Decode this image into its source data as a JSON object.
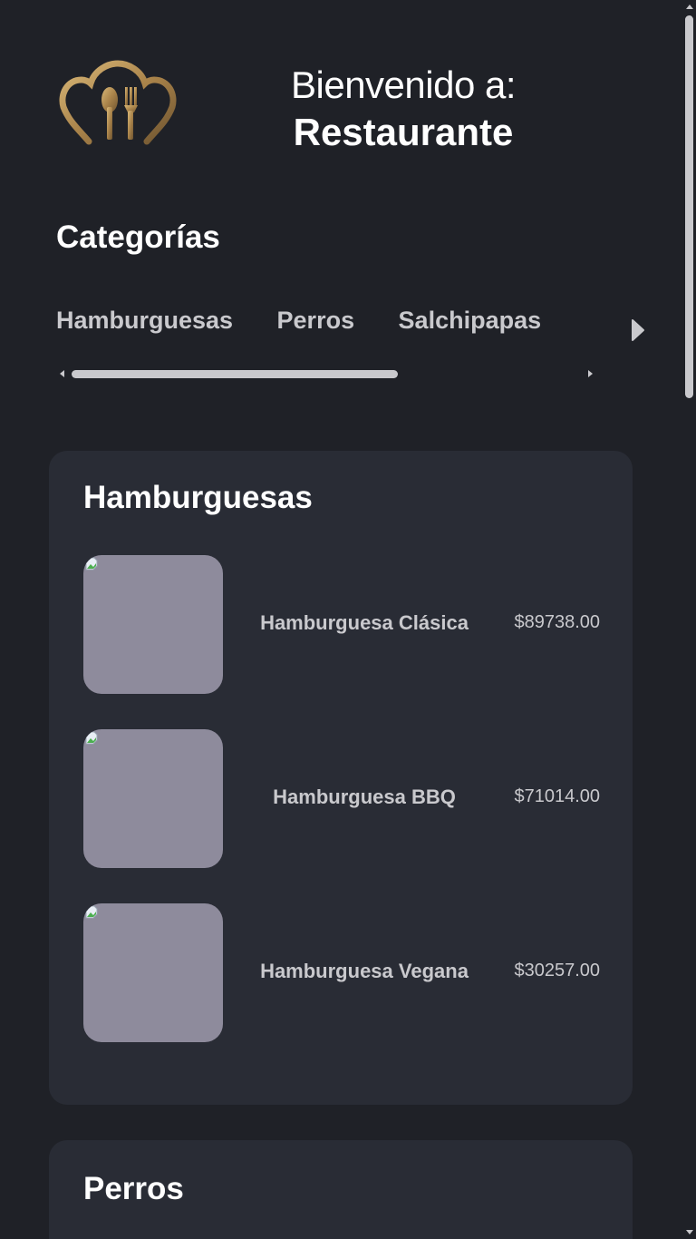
{
  "header": {
    "logo_icon": "chef-hat-spoon-fork-icon",
    "welcome_line": "Bienvenido a:",
    "restaurant_name": "Restaurante",
    "logo_color": "#b8935a"
  },
  "categories": {
    "title": "Categorías",
    "items": [
      {
        "label": "Hamburguesas"
      },
      {
        "label": "Perros"
      },
      {
        "label": "Salchipapas"
      }
    ],
    "next_icon": "triangle-right-icon"
  },
  "sections": [
    {
      "title": "Hamburguesas",
      "products": [
        {
          "name": "Hamburguesa Clásica",
          "price": "$89738.00",
          "image_icon": "broken-image-icon"
        },
        {
          "name": "Hamburguesa BBQ",
          "price": "$71014.00",
          "image_icon": "broken-image-icon"
        },
        {
          "name": "Hamburguesa Vegana",
          "price": "$30257.00",
          "image_icon": "broken-image-icon"
        }
      ]
    },
    {
      "title": "Perros",
      "products": []
    }
  ],
  "colors": {
    "background": "#1f2127",
    "card": "#292c35",
    "image_placeholder": "#8e8b9c",
    "muted_text": "#c9c9cd",
    "accent_gold": "#b8935a"
  }
}
